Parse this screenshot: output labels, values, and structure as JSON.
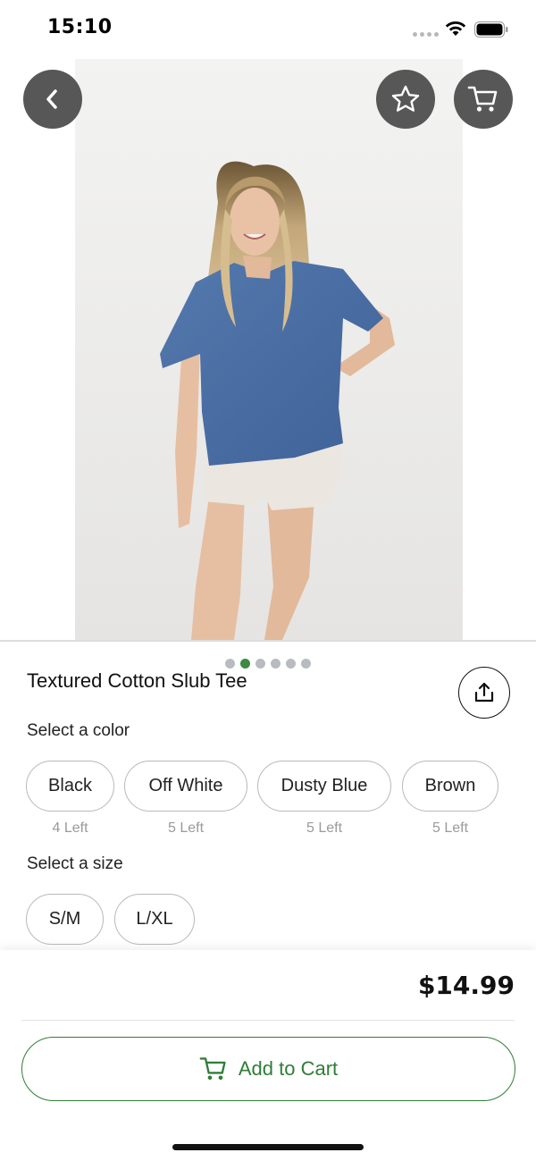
{
  "status_bar": {
    "time": "15:10"
  },
  "header": {
    "back_icon": "chevron-left-icon",
    "favorite_icon": "star-icon",
    "cart_icon": "cart-icon"
  },
  "gallery": {
    "total_images": 6,
    "active_index": 1
  },
  "product": {
    "title": "Textured Cotton Slub Tee",
    "share_icon": "share-icon",
    "color_label": "Select a color",
    "colors": [
      {
        "name": "Black",
        "stock": "4 Left"
      },
      {
        "name": "Off White",
        "stock": "5 Left"
      },
      {
        "name": "Dusty Blue",
        "stock": "5 Left"
      },
      {
        "name": "Brown",
        "stock": "5 Left"
      }
    ],
    "size_label": "Select a size",
    "sizes": [
      "S/M",
      "L/XL"
    ]
  },
  "purchase": {
    "price": "$14.99",
    "add_to_cart_label": "Add to Cart",
    "accent_color": "#2f7d37"
  }
}
